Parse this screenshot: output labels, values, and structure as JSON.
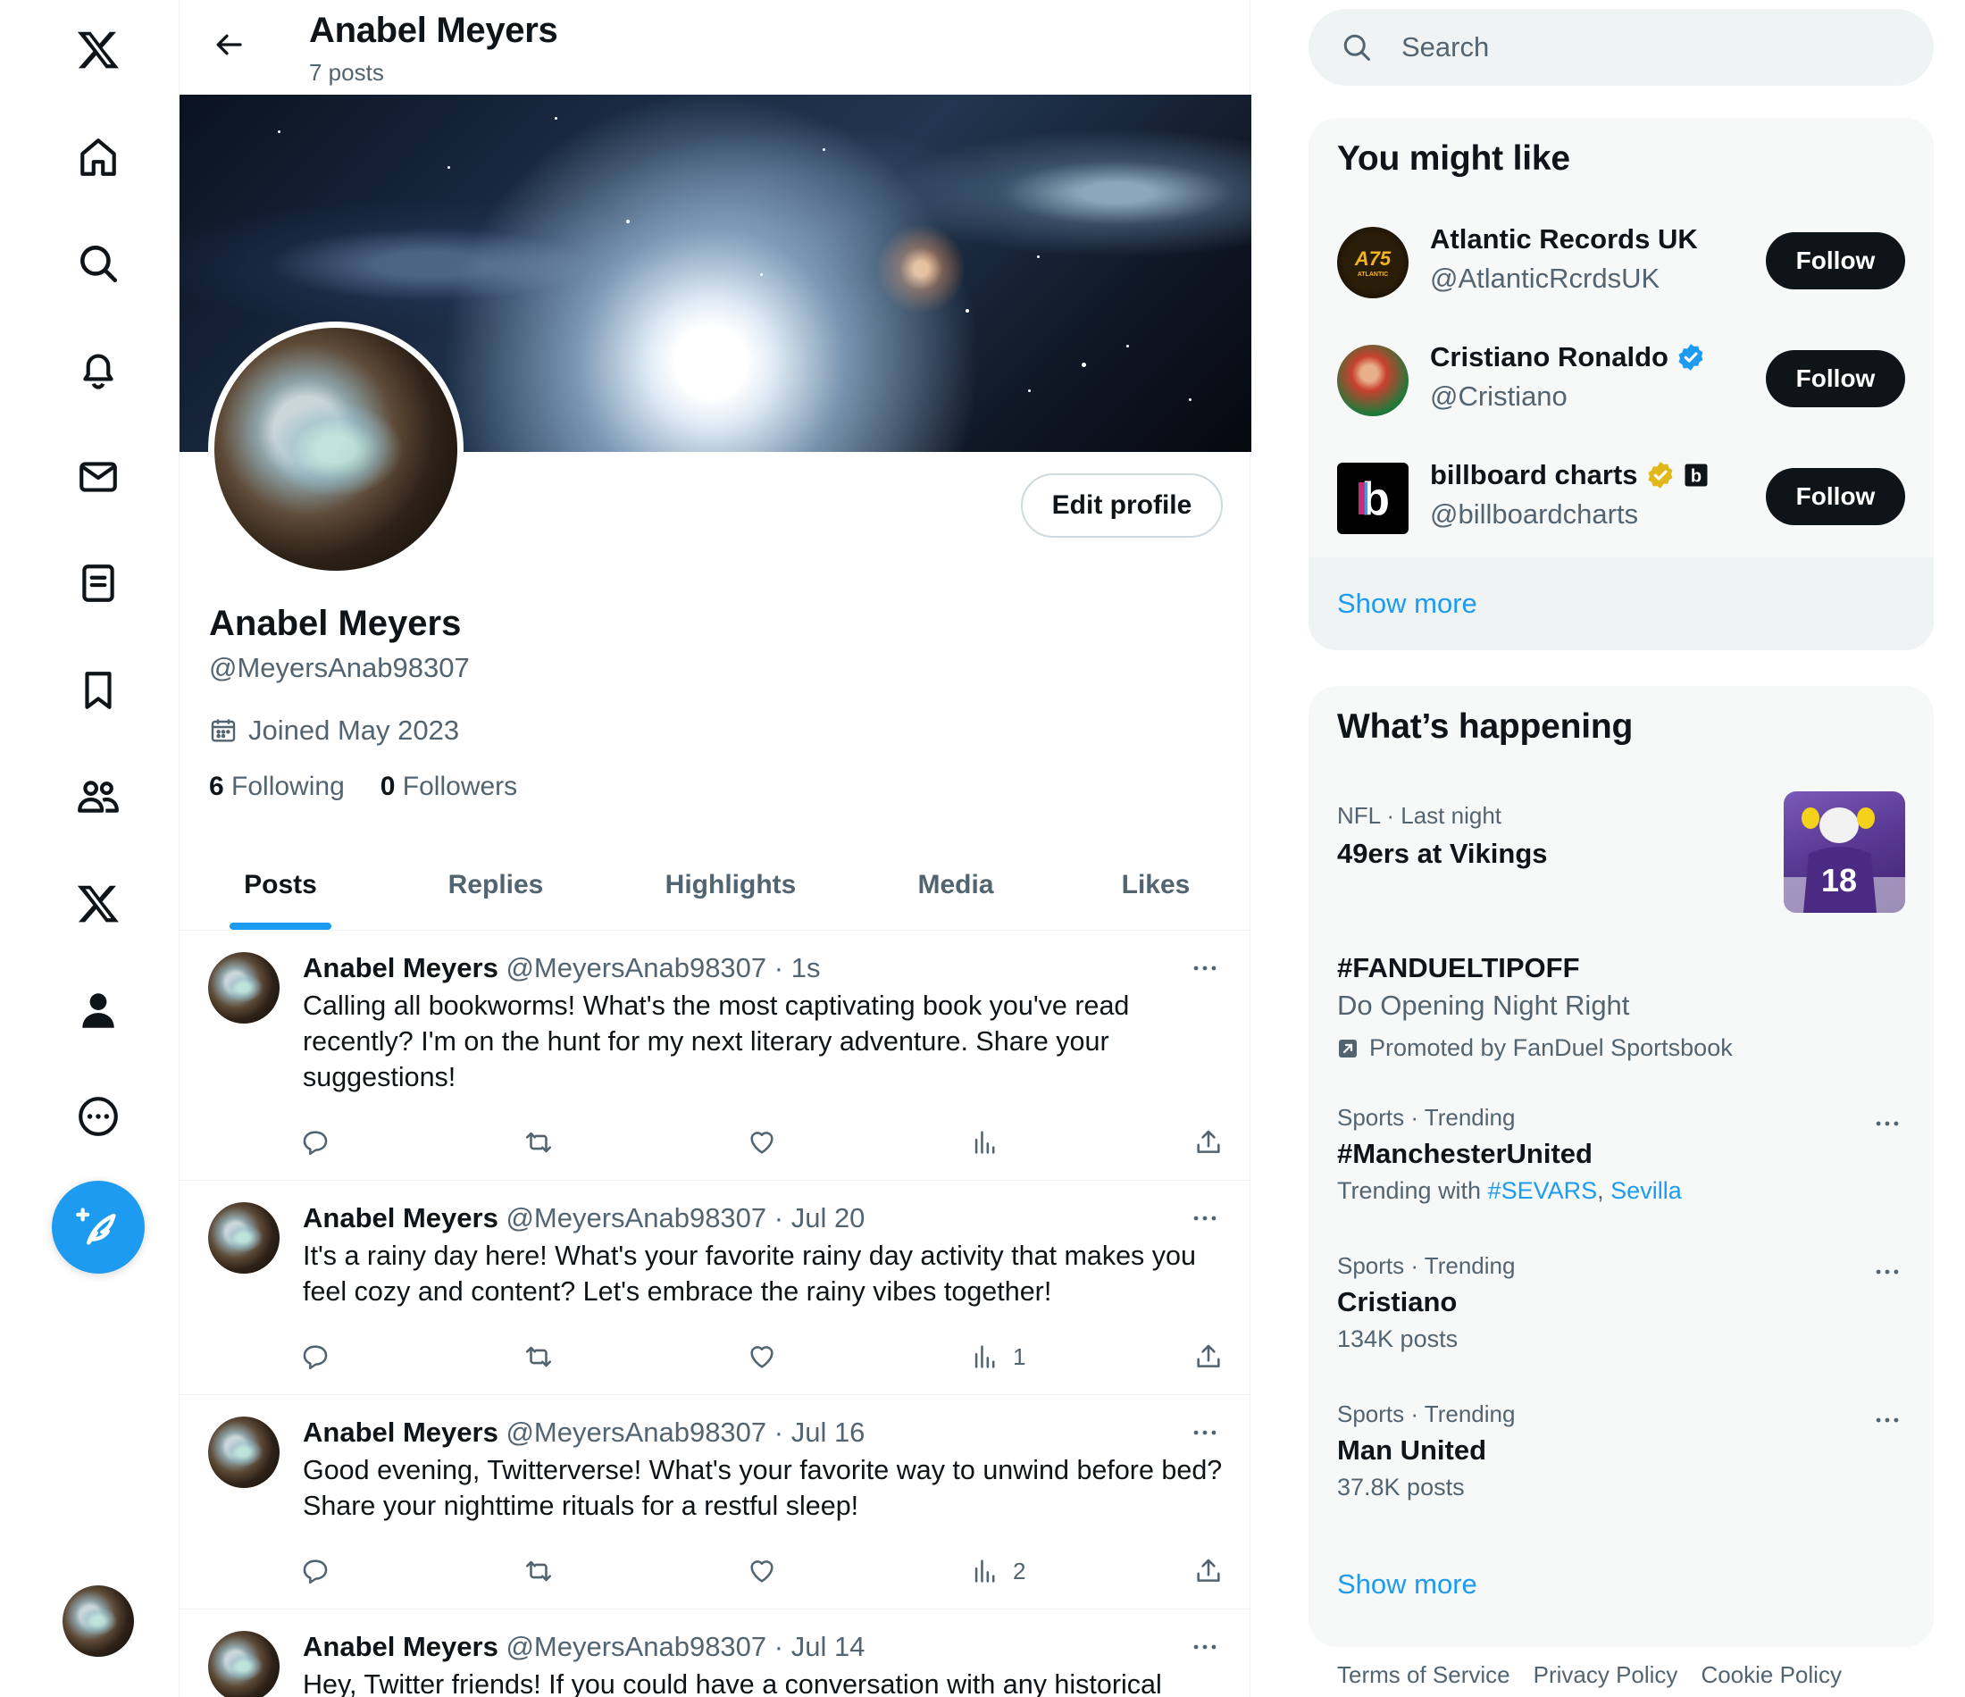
{
  "nav": {
    "items": [
      "x-logo",
      "home",
      "explore",
      "notifications",
      "messages",
      "lists",
      "bookmarks",
      "communities",
      "premium",
      "profile",
      "more"
    ],
    "compose_icon": "feather-plus-icon"
  },
  "header": {
    "name": "Anabel Meyers",
    "posts_count": "7 posts"
  },
  "profile": {
    "name": "Anabel Meyers",
    "handle": "@MeyersAnab98307",
    "joined": "Joined May 2023",
    "following_count": "6",
    "following_label": "Following",
    "followers_count": "0",
    "followers_label": "Followers",
    "edit_label": "Edit profile"
  },
  "tabs": [
    "Posts",
    "Replies",
    "Highlights",
    "Media",
    "Likes"
  ],
  "active_tab": "Posts",
  "posts": [
    {
      "name": "Anabel Meyers",
      "meta": "@MeyersAnab98307 · 1s",
      "text": "Calling all bookworms! What's the most captivating book you've read recently? I'm on the hunt for my next literary adventure. Share your suggestions!",
      "views": ""
    },
    {
      "name": "Anabel Meyers",
      "meta": "@MeyersAnab98307 · Jul 20",
      "text": "It's a rainy day here! What's your favorite rainy day activity that makes you feel cozy and content? Let's embrace the rainy vibes together!",
      "views": "1"
    },
    {
      "name": "Anabel Meyers",
      "meta": "@MeyersAnab98307 · Jul 16",
      "text": "Good evening, Twitterverse! What's your favorite way to unwind before bed? Share your nighttime rituals for a restful sleep!",
      "views": "2"
    },
    {
      "name": "Anabel Meyers",
      "meta": "@MeyersAnab98307 · Jul 14",
      "text": "Hey, Twitter friends! If you could have a conversation with any historical",
      "views": ""
    }
  ],
  "search": {
    "placeholder": "Search"
  },
  "who_to_follow": {
    "title": "You might like",
    "accounts": [
      {
        "name": "Atlantic Records UK",
        "handle": "@AtlanticRcrdsUK",
        "badge": "",
        "follow_label": "Follow"
      },
      {
        "name": "Cristiano Ronaldo",
        "handle": "@Cristiano",
        "badge": "blue-verified",
        "follow_label": "Follow"
      },
      {
        "name": "billboard charts",
        "handle": "@billboardcharts",
        "badge": "gold-verified",
        "follow_label": "Follow"
      }
    ],
    "show_more": "Show more"
  },
  "trends": {
    "title": "What’s happening",
    "items": [
      {
        "context": "NFL · Last night",
        "title": "49ers at Vikings"
      },
      {
        "context": "",
        "title": "#FANDUELTIPOFF",
        "sub": "Do Opening Night Right",
        "promoted": "Promoted by FanDuel Sportsbook"
      },
      {
        "context": "Sports · Trending",
        "title": "#ManchesterUnited",
        "sub_prefix": "Trending with",
        "links": [
          "#SEVARS",
          "Sevilla"
        ]
      },
      {
        "context": "Sports · Trending",
        "title": "Cristiano",
        "sub": "134K posts"
      },
      {
        "context": "Sports · Trending",
        "title": "Man United",
        "sub": "37.8K posts"
      }
    ],
    "show_more": "Show more"
  },
  "footer": [
    "Terms of Service",
    "Privacy Policy",
    "Cookie Policy"
  ],
  "colors": {
    "accent": "#1d9bf0",
    "text": "#0f1419",
    "muted": "#536471",
    "card": "#f7f9f9"
  }
}
